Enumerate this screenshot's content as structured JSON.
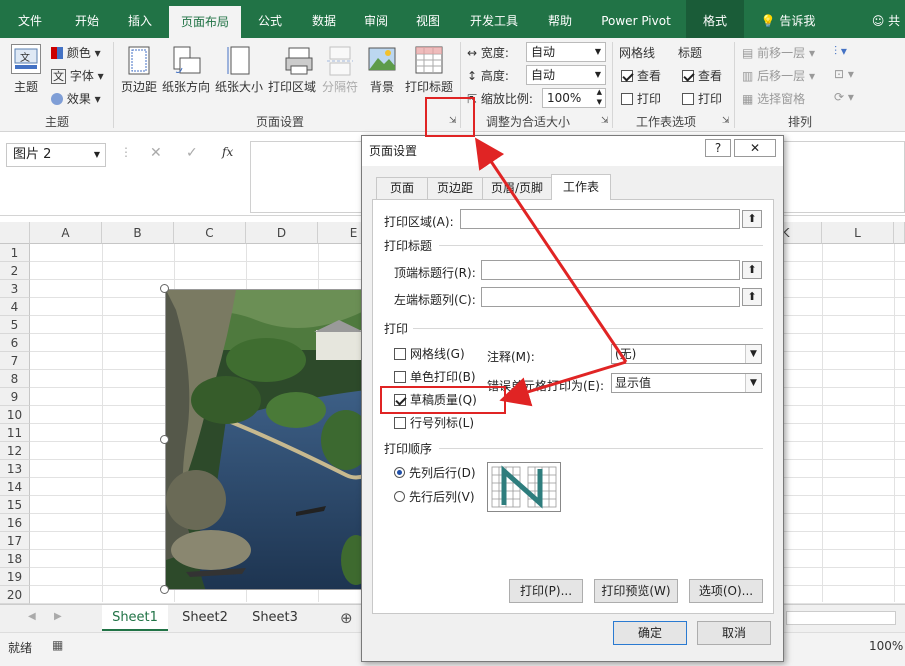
{
  "ribbon_tabs": [
    "文件",
    "开始",
    "插入",
    "页面布局",
    "公式",
    "数据",
    "审阅",
    "视图",
    "开发工具",
    "帮助",
    "Power Pivot",
    "格式"
  ],
  "active_tab": "页面布局",
  "tell_me": "告诉我",
  "share": "共",
  "theme_group": {
    "themes": "主题",
    "colors": "颜色",
    "fonts": "字体",
    "effects": "效果",
    "label": "主题"
  },
  "page_setup_group": {
    "margins": "页边距",
    "orientation": "纸张方向",
    "size": "纸张大小",
    "print_area": "打印区域",
    "breaks": "分隔符",
    "background": "背景",
    "print_titles": "打印标题",
    "label": "页面设置"
  },
  "scale_group": {
    "width_label": "宽度:",
    "width_value": "自动",
    "height_label": "高度:",
    "height_value": "自动",
    "scale_label": "缩放比例:",
    "scale_value": "100%",
    "label": "调整为合适大小"
  },
  "sheet_options_group": {
    "gridlines": "网格线",
    "headings": "标题",
    "view": "查看",
    "print": "打印",
    "label": "工作表选项"
  },
  "arrange_group": {
    "bring_forward": "前移一层",
    "send_backward": "后移一层",
    "selection_pane": "选择窗格",
    "label": "排列"
  },
  "formula_bar": {
    "name_box": "图片 2",
    "cancel": "✕",
    "enter": "✓",
    "fx": "fx"
  },
  "columns": [
    "A",
    "B",
    "C",
    "D",
    "E",
    "K",
    "L"
  ],
  "rows": [
    "1",
    "2",
    "3",
    "4",
    "5",
    "6",
    "7",
    "8",
    "9",
    "10",
    "11",
    "12",
    "13",
    "14",
    "15",
    "16",
    "17",
    "18",
    "19",
    "20"
  ],
  "sheets": [
    "Sheet1",
    "Sheet2",
    "Sheet3"
  ],
  "active_sheet": "Sheet1",
  "status": {
    "ready": "就绪",
    "zoom": "100%"
  },
  "dialog": {
    "title": "页面设置",
    "help": "?",
    "close": "✕",
    "tabs": [
      "页面",
      "页边距",
      "页眉/页脚",
      "工作表"
    ],
    "active_tab": "工作表",
    "print_area_label": "打印区域(A):",
    "print_titles_label": "打印标题",
    "top_rows_label": "顶端标题行(R):",
    "left_cols_label": "左端标题列(C):",
    "print_section": "打印",
    "options": [
      {
        "label": "网格线(G)",
        "checked": false
      },
      {
        "label": "单色打印(B)",
        "checked": false
      },
      {
        "label": "草稿质量(Q)",
        "checked": true
      },
      {
        "label": "行号列标(L)",
        "checked": false
      }
    ],
    "comments_label": "注释(M):",
    "comments_value": "(无)",
    "errors_label": "错误单元格打印为(E):",
    "errors_value": "显示值",
    "page_order_label": "打印顺序",
    "order_options": [
      {
        "label": "先列后行(D)",
        "checked": true
      },
      {
        "label": "先行后列(V)",
        "checked": false
      }
    ],
    "print_btn": "打印(P)...",
    "preview_btn": "打印预览(W)",
    "options_btn": "选项(O)...",
    "ok_btn": "确定",
    "cancel_btn": "取消"
  },
  "colors": {
    "excel_green": "#217346",
    "highlight_red": "#e02424"
  }
}
